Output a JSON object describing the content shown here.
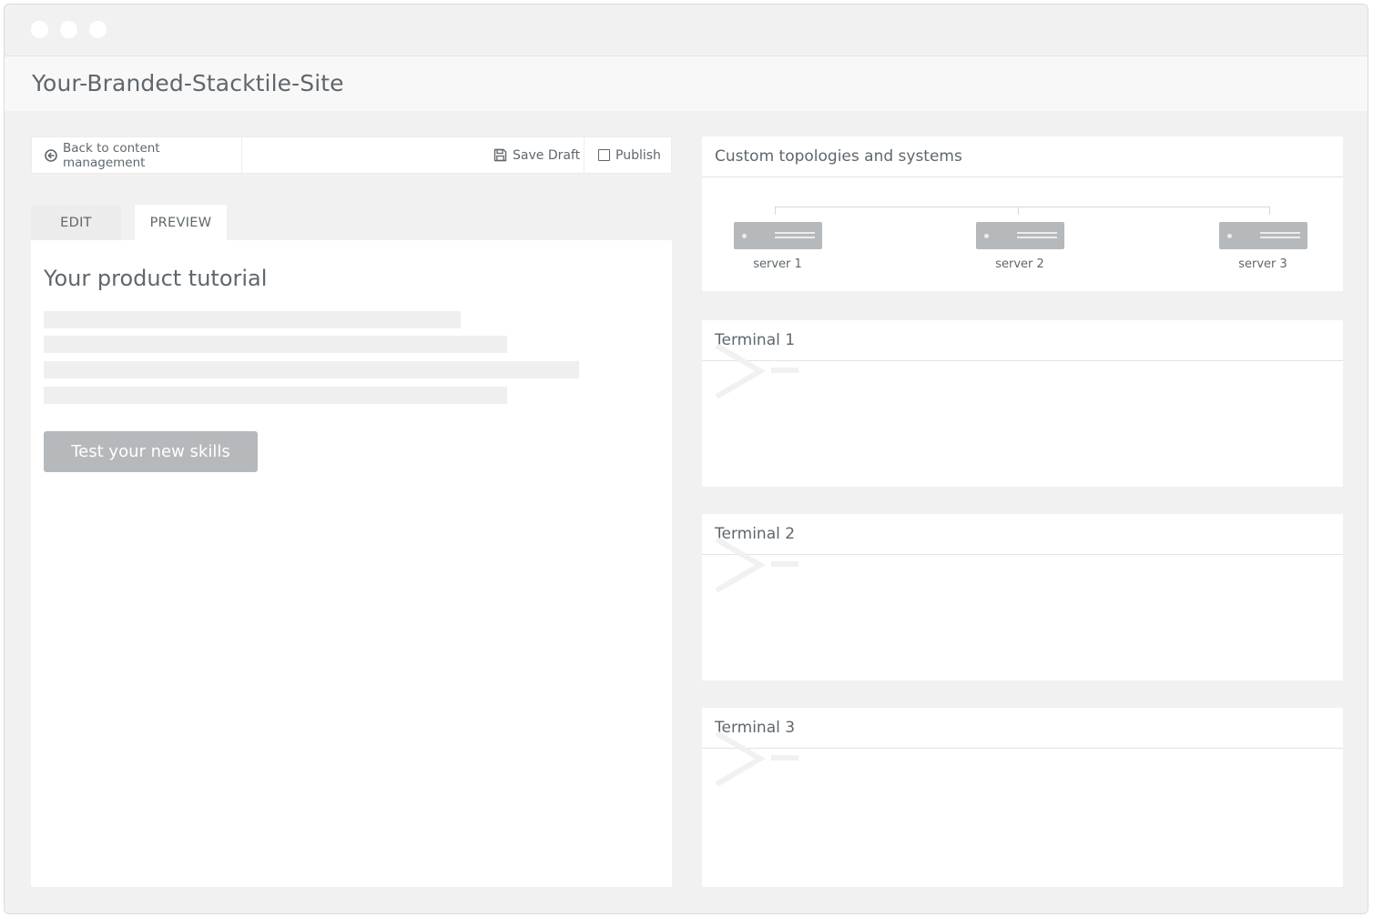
{
  "window": {
    "site_title": "Your-Branded-Stacktile-Site"
  },
  "toolbar": {
    "back_label": "Back to content management",
    "save_label": "Save Draft",
    "publish_label": "Publish"
  },
  "tabs": [
    {
      "label": "EDIT",
      "active": false
    },
    {
      "label": "PREVIEW",
      "active": true
    }
  ],
  "preview": {
    "title": "Your product tutorial",
    "button_label": "Test your new skills"
  },
  "topology": {
    "title": "Custom topologies and systems",
    "servers": [
      {
        "label": "server 1"
      },
      {
        "label": "server 2"
      },
      {
        "label": "server 3"
      }
    ]
  },
  "terminals": [
    {
      "title": "Terminal 1"
    },
    {
      "title": "Terminal 2"
    },
    {
      "title": "Terminal 3"
    }
  ],
  "colors": {
    "window_bg": "#f1f1f1",
    "panel_bg": "#ffffff",
    "text": "#5f676d",
    "button_bg": "#b5b9bc",
    "server_bg": "#b5b9bc",
    "placeholder": "#efefef"
  }
}
